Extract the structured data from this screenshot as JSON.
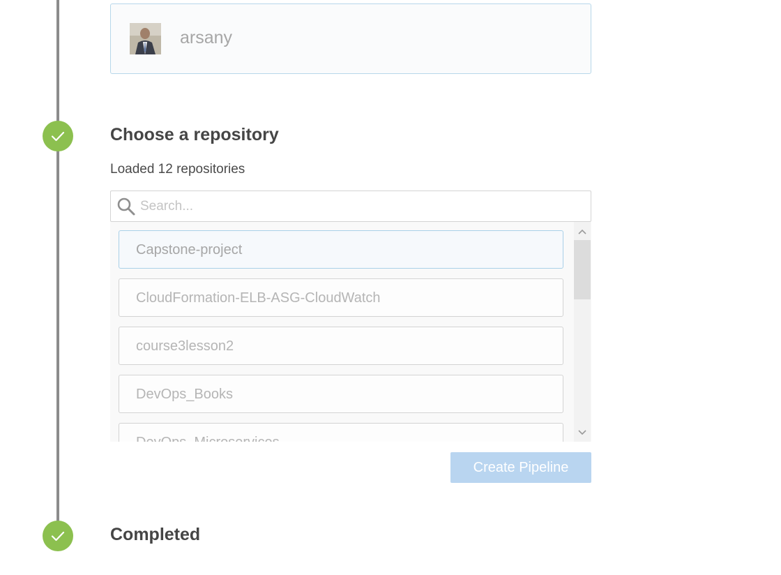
{
  "account": {
    "name": "arsany"
  },
  "steps": {
    "choose_repo": {
      "title": "Choose a repository",
      "status": "Loaded 12 repositories"
    },
    "completed": {
      "title": "Completed"
    }
  },
  "search": {
    "placeholder": "Search..."
  },
  "repositories": [
    "Capstone-project",
    "CloudFormation-ELB-ASG-CloudWatch",
    "course3lesson2",
    "DevOps_Books",
    "DevOps_Microservices"
  ],
  "buttons": {
    "create_pipeline": "Create Pipeline"
  },
  "colors": {
    "check_green": "#8cc04f",
    "button_disabled_blue": "#b9d5f0",
    "selected_border": "#a9d0e8"
  }
}
